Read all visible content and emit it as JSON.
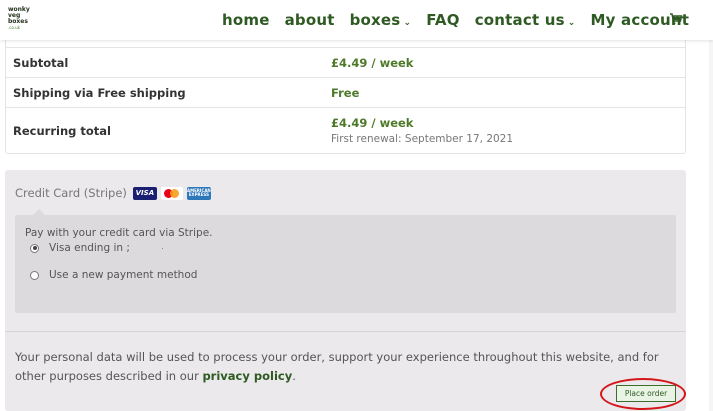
{
  "header": {
    "logo_lines": [
      "wonky",
      "veg",
      "boxes",
      ".co.uk"
    ],
    "nav": [
      {
        "label": "home",
        "has_dropdown": false
      },
      {
        "label": "about",
        "has_dropdown": false
      },
      {
        "label": "boxes",
        "has_dropdown": true
      },
      {
        "label": "FAQ",
        "has_dropdown": false
      },
      {
        "label": "contact us",
        "has_dropdown": true
      },
      {
        "label": "My account",
        "has_dropdown": false
      }
    ],
    "cart_icon": "cart-icon"
  },
  "totals": {
    "subtotal_label": "Subtotal",
    "subtotal_value": "£4.49 / week",
    "shipping_label": "Shipping via Free shipping",
    "shipping_value": "Free",
    "recurring_label": "Recurring total",
    "recurring_value": "£4.49 / week",
    "first_renewal": "First renewal: September 17, 2021"
  },
  "payment": {
    "method_title": "Credit Card (Stripe)",
    "card_icons": [
      "visa-icon",
      "mastercard-icon",
      "amex-icon"
    ],
    "visa_text": "VISA",
    "amex_text": "AMERICAN EXPRESS",
    "description": "Pay with your credit card via Stripe.",
    "saved_card_label": "Visa ending in ;",
    "new_method_label": "Use a new payment method"
  },
  "privacy": {
    "text_before": "Your personal data will be used to process your order, support your experience throughout this website, and for other purposes described in our ",
    "link_text": "privacy policy",
    "text_after": "."
  },
  "place_order": {
    "label": "Place order"
  },
  "colors": {
    "brand_green": "#2f5a23",
    "value_green": "#4d7a2a",
    "highlight_red": "#d4161a",
    "payment_bg": "#ebe9eb"
  }
}
